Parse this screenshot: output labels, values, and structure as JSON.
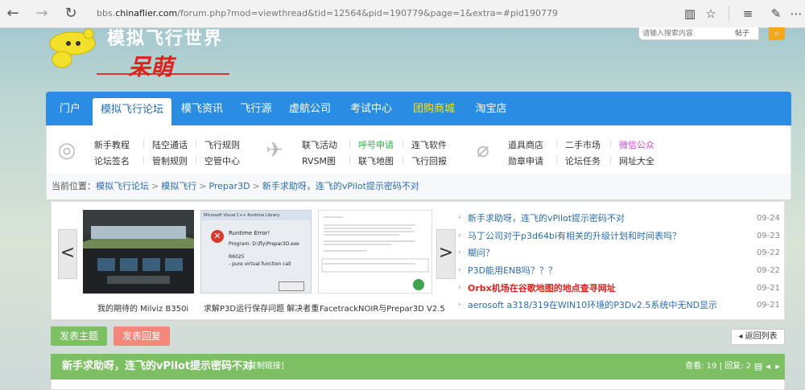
{
  "browser": {
    "url_prefix": "bbs.",
    "url_domain": "chinaflier.com",
    "url_rest": "/forum.php?mod=viewthread&tid=12564&pid=190779&page=1&extra=#pid190779"
  },
  "header": {
    "logo_top": "模拟飞行世界",
    "logo_bottom": "呆萌",
    "search_placeholder": "请输入搜索内容",
    "search_category": "帖子"
  },
  "mainnav": {
    "items": [
      "门户",
      "模拟飞行论坛",
      "模飞资讯",
      "飞行源",
      "虚航公司",
      "考试中心",
      "团购商城",
      "淘宝店"
    ]
  },
  "subnav": {
    "group1": [
      "新手教程",
      "陆空通话",
      "飞行规则",
      "论坛签名",
      "管制规则",
      "空管中心"
    ],
    "group2": [
      "联飞活动",
      "呼号申请",
      "连飞软件",
      "RVSM图",
      "联飞地图",
      "飞行回报"
    ],
    "group3": [
      "道具商店",
      "二手市场",
      "微信公众",
      "勋章申请",
      "论坛任务",
      "网址大全"
    ]
  },
  "breadcrumb": {
    "label": "当前位置：",
    "items": [
      "模拟飞行论坛",
      "模拟飞行",
      "Prepar3D",
      "新手求助呀，连飞的vPilot提示密码不对"
    ]
  },
  "slider": {
    "prev": "<",
    "next": ">",
    "captions": [
      "我的期待的 Milviz B350i",
      "求解P3D运行保存问题 解决者重",
      "FacetrackNOIR与Prepar3D V2.5"
    ],
    "error_dialog": {
      "title": "Microsoft Visual C++ Runtime Library",
      "heading": "Runtime Error!",
      "program": "Program: D:\\fly\\Prepar3D.exe",
      "code": "R6025",
      "msg": "- pure virtual function call"
    }
  },
  "threads": [
    {
      "title": "新手求助呀，连飞的vPilot提示密码不对",
      "date": "09-24",
      "highlight": false
    },
    {
      "title": "马丁公司对于p3d64bi有相关的升级计划和时间表吗？",
      "date": "09-23",
      "highlight": false
    },
    {
      "title": "糊问？",
      "date": "09-22",
      "highlight": false
    },
    {
      "title": "P3D能用ENB吗？？？",
      "date": "09-22",
      "highlight": false
    },
    {
      "title": "Orbx机场在谷歌地图的地点查寻网址",
      "date": "09-21",
      "highlight": true
    },
    {
      "title": "aerosoft a318/319在WIN10环境的P3Dv2.5系统中无ND显示",
      "date": "09-21",
      "highlight": false
    }
  ],
  "actions": {
    "new_thread": "发表主题",
    "reply": "发表回复",
    "back_list": "◂ 返回列表"
  },
  "thread_bar": {
    "title": "新手求助呀，连飞的vPilot提示密码不对",
    "copy_link": "[复制链接]",
    "stats": "查看: 19 | 回复: 2"
  },
  "colors": {
    "nav_blue": "#2a8ce2",
    "green": "#7cc063",
    "pink": "#f4877a"
  }
}
